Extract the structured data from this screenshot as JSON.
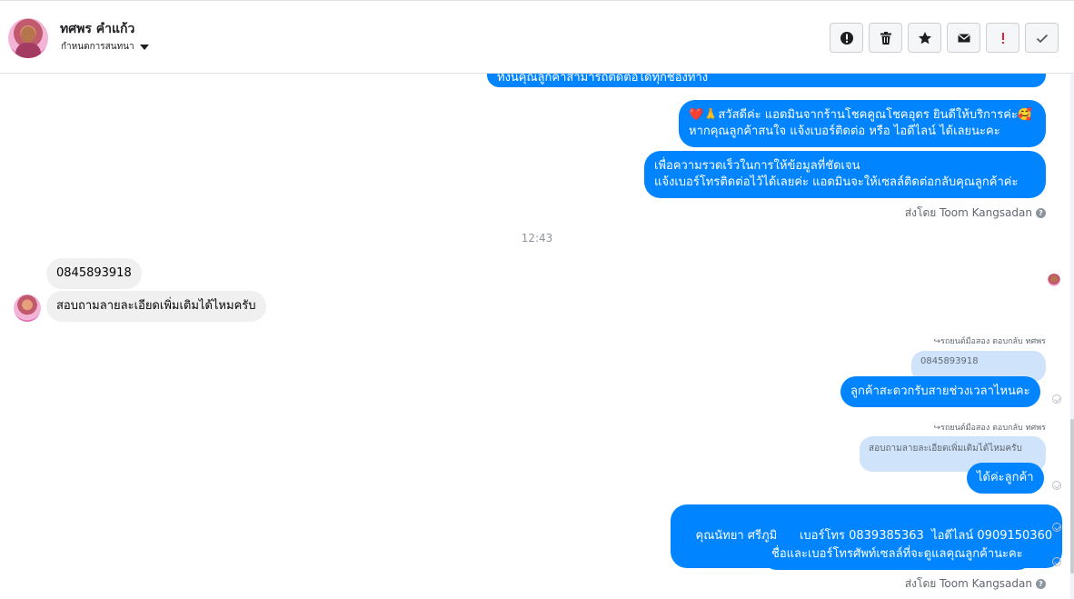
{
  "header": {
    "contact_name": "ทศพร คำแก้ว",
    "subtitle": "กำหนดการสนทนา",
    "tools": [
      {
        "icon": "alert-circle-icon"
      },
      {
        "icon": "trash-icon"
      },
      {
        "icon": "star-icon"
      },
      {
        "icon": "envelope-icon"
      },
      {
        "icon": "exclamation-icon"
      },
      {
        "icon": "checkmark-icon"
      }
    ]
  },
  "messages": {
    "top_partial": "ทั้งนี้คุณลูกค้าสามารถติดต่อได้ทุกช่องทาง",
    "greeting_line1": "❤️🙏สวัสดีค่ะ แอดมินจากร้านโชคคูณโชคอุดร ยินดีให้บริการค่ะ🥰",
    "greeting_line2": "หากคุณลูกค้าสนใจ แจ้งเบอร์ติดต่อ หรือ ไอดีไลน์ ได้เลยนะคะ",
    "speed_line1": "เพื่อความรวดเร็วในการให้ข้อมูลที่ชัดเจน",
    "speed_line2": "แจ้งเบอร์โทรติดต่อไว้ได้เลยค่ะ แอดมินจะให้เซลล์ติดต่อกลับคุณลูกค้าค่ะ",
    "sent_by_1": "ส่งโดย Toom Kangsadan",
    "timestamp": "12:43",
    "customer_phone": "0845893918",
    "customer_question": "สอบถามลายละเอียดเพิ่มเติมได้ไหมครับ",
    "reply_label_1": "↪รถยนต์มือสอง ตอบกลับ ทศพร",
    "quote_1": "0845893918",
    "reply_1": "ลูกค้าสะดวกรับสายช่วงเวลาไหนคะ",
    "reply_label_2": "↪รถยนต์มือสอง ตอบกลับ ทศพร",
    "quote_2": "สอบถามลายละเอียดเพิ่มเติมได้ไหมครับ",
    "reply_2": "ได้ค่ะลูกค้า",
    "contact_info": "คุณนัทยา ศรีภูมิ      เบอร์โทร 0839385363  ไอดีไลน์ 0909150360",
    "contact_note": "ชื่อและเบอร์โทรศัพท์เซลล์ที่จะดูแลคุณลูกค้านะคะ",
    "sent_by_2": "ส่งโดย Toom Kangsadan",
    "help_mark": "?"
  },
  "colors": {
    "page_bubble": "#0084ff",
    "customer_bubble": "#f0f0f0",
    "quote_bubble": "#cfe3fb"
  }
}
